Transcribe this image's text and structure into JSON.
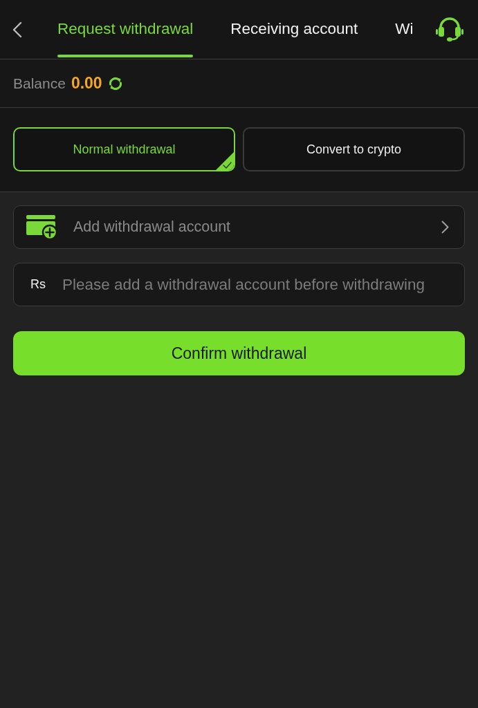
{
  "header": {
    "tabs": [
      {
        "label": "Request withdrawal",
        "selected": true
      },
      {
        "label": "Receiving account",
        "selected": false
      },
      {
        "label": "Wi",
        "selected": false
      }
    ]
  },
  "balance": {
    "label": "Balance",
    "amount": "0.00"
  },
  "withdrawal_types": [
    {
      "label": "Normal withdrawal",
      "selected": true
    },
    {
      "label": "Convert to crypto",
      "selected": false
    }
  ],
  "account_row": {
    "label": "Add withdrawal account"
  },
  "amount_field": {
    "currency": "Rs",
    "placeholder": "Please add a withdrawal account before withdrawing"
  },
  "confirm_button": {
    "label": "Confirm withdrawal"
  }
}
